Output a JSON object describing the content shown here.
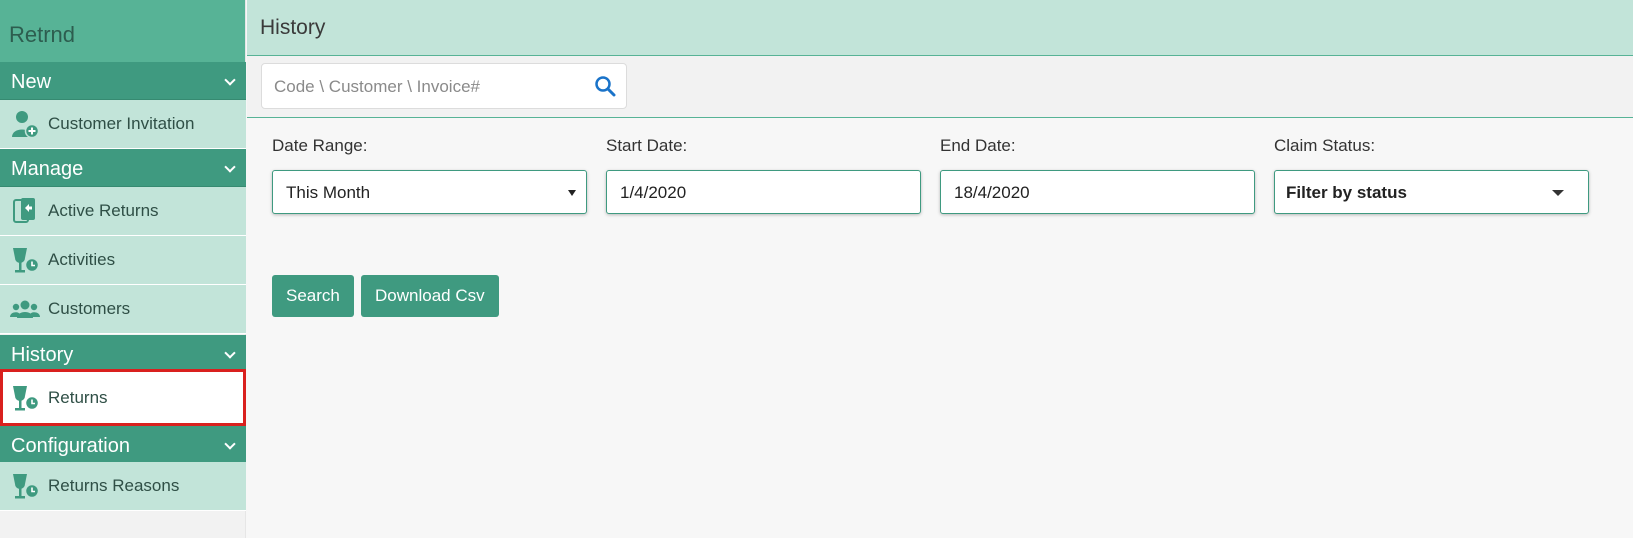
{
  "app": {
    "brand": "Retrnd"
  },
  "colors": {
    "accent": "#3f9a80",
    "brand_bg": "#57b396",
    "light_green": "#c2e4d9",
    "highlight_border": "#d9201e"
  },
  "sidebar": {
    "sections": [
      {
        "label": "New",
        "items": [
          {
            "label": "Customer Invitation",
            "icon": "user-plus-icon"
          }
        ]
      },
      {
        "label": "Manage",
        "items": [
          {
            "label": "Active Returns",
            "icon": "phone-return-icon"
          },
          {
            "label": "Activities",
            "icon": "glass-clock-icon"
          },
          {
            "label": "Customers",
            "icon": "users-icon"
          }
        ]
      },
      {
        "label": "History",
        "items": [
          {
            "label": "Returns",
            "icon": "glass-clock-icon",
            "active": true
          }
        ]
      },
      {
        "label": "Configuration",
        "items": [
          {
            "label": "Returns Reasons",
            "icon": "glass-clock-icon"
          }
        ]
      }
    ]
  },
  "header": {
    "title": "History"
  },
  "search": {
    "placeholder": "Code \\ Customer \\ Invoice#",
    "value": ""
  },
  "filters": {
    "date_range": {
      "label": "Date Range:",
      "value": "This Month"
    },
    "start_date": {
      "label": "Start Date:",
      "value": "1/4/2020"
    },
    "end_date": {
      "label": "End Date:",
      "value": "18/4/2020"
    },
    "claim_status": {
      "label": "Claim Status:",
      "value": "Filter by status"
    }
  },
  "actions": {
    "search_label": "Search",
    "download_label": "Download Csv"
  }
}
